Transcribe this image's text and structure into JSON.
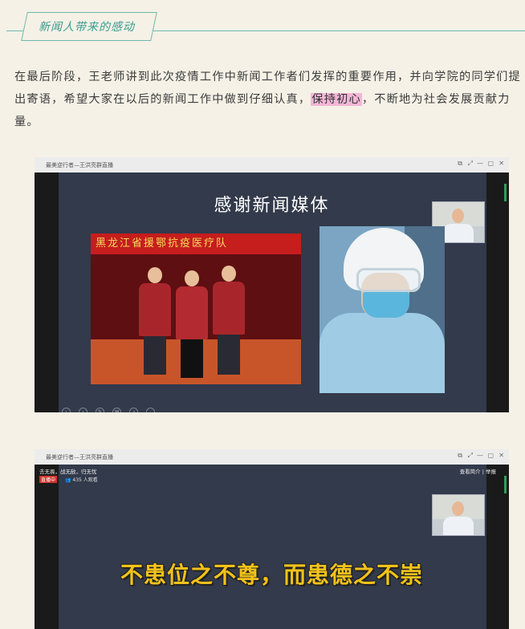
{
  "header": {
    "title": "新闻人带来的感动"
  },
  "article": {
    "para_line1": "在最后阶段，王老师讲到此次疫情工作中新闻工作者们发挥的重要作用，并向学院的同学们提",
    "para_line2_before": "出寄语，希望大家在以后的新闻工作中做到仔细认真，",
    "para_highlight": "保持初心",
    "para_line2_after": "，不断地为社会发展贡献力",
    "para_line3": "量。"
  },
  "window1": {
    "title": "最美逆行者—王洪亮群直播",
    "controls": [
      "⧉",
      "⤢",
      "—",
      "▢",
      "✕"
    ],
    "slide_title": "感谢新闻媒体",
    "photo_banner": "黑龙江省援鄂抗疫医疗队"
  },
  "window2": {
    "title": "最美逆行者—王洪亮群直播",
    "controls": [
      "⧉",
      "⤢",
      "—",
      "▢",
      "✕"
    ],
    "subtitle": "去无畏，战无敌，归无忧",
    "live_badge": "直播中",
    "viewers": "435 人观看",
    "link_intro": "查看简介",
    "link_report": "举报",
    "quote": "不患位之不尊，而患德之不崇"
  },
  "colors": {
    "accent": "#3a9a8f",
    "highlight": "#f4b6d7",
    "quote": "#f3c21b"
  }
}
